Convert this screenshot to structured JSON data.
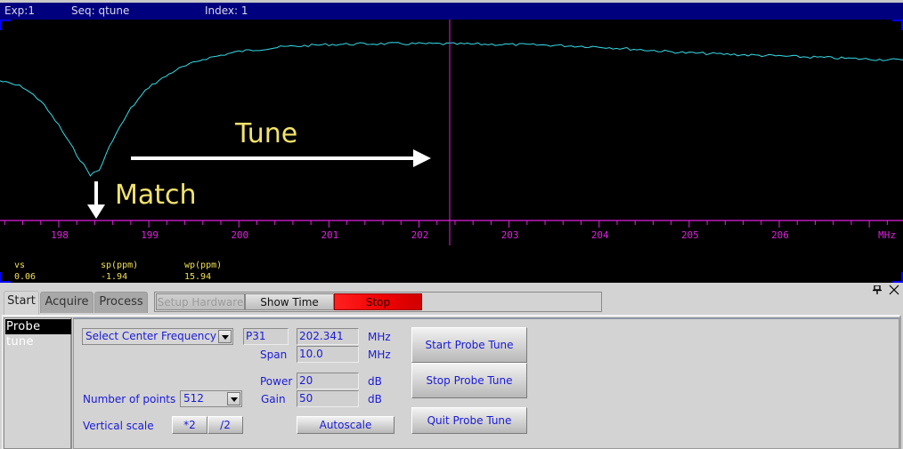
{
  "status_bar": {
    "exp": "Exp:1",
    "seq": "Seq: qtune",
    "index": "Index: 1"
  },
  "canvas": {
    "background": "#000000",
    "trace_color": "#33dde8",
    "axis_color": "#e020e0",
    "cursor_freq_mhz": 202.341,
    "annotations": {
      "tune_label": "Tune",
      "match_label": "Match",
      "label_color": "#f3e36b",
      "arrow_color": "#ffffff"
    },
    "readouts": [
      {
        "label": "vs",
        "value": "0.06"
      },
      {
        "label": "sp(ppm)",
        "value": "-1.94"
      },
      {
        "label": "wp(ppm)",
        "value": "15.94"
      }
    ]
  },
  "chart_data": {
    "type": "line",
    "title": "",
    "xlabel": "MHz",
    "ylabel": "",
    "xlim": [
      197.34,
      207.34
    ],
    "x_ticks": [
      198,
      199,
      200,
      201,
      202,
      203,
      204,
      205,
      206
    ],
    "x_tick_labels": [
      "198",
      "199",
      "200",
      "201",
      "202",
      "203",
      "204",
      "205",
      "206"
    ],
    "minor_tick_step": 0.2,
    "cursor_x": 202.341,
    "grid": false,
    "series": [
      {
        "name": "probe tune reflection",
        "x": [
          197.34,
          197.6,
          197.8,
          198.0,
          198.2,
          198.35,
          198.45,
          198.6,
          198.8,
          199.0,
          199.3,
          199.6,
          200.0,
          200.5,
          201.0,
          201.5,
          202.0,
          202.5,
          203.0,
          203.5,
          204.0,
          204.5,
          205.0,
          205.5,
          206.0,
          206.5,
          207.0,
          207.34
        ],
        "y": [
          0.73,
          0.69,
          0.6,
          0.44,
          0.25,
          0.12,
          0.15,
          0.35,
          0.55,
          0.69,
          0.8,
          0.87,
          0.92,
          0.95,
          0.965,
          0.97,
          0.97,
          0.968,
          0.965,
          0.96,
          0.95,
          0.93,
          0.91,
          0.9,
          0.89,
          0.88,
          0.87,
          0.865
        ]
      }
    ]
  },
  "panel": {
    "tabs": [
      {
        "label": "Start",
        "active": true
      },
      {
        "label": "Acquire",
        "active": false
      },
      {
        "label": "Process",
        "active": false
      }
    ],
    "toolbar": {
      "setup_hardware": "Setup Hardware",
      "show_time": "Show Time",
      "stop": "Stop"
    },
    "side_list": [
      "Probe tune"
    ],
    "form": {
      "center_freq_select": "Select Center Frequency",
      "nucleus": "P31",
      "center_freq": "202.341",
      "center_freq_unit": "MHz",
      "span_label": "Span",
      "span": "10.0",
      "span_unit": "MHz",
      "power_label": "Power",
      "power": "20",
      "power_unit": "dB",
      "gain_label": "Gain",
      "gain": "50",
      "gain_unit": "dB",
      "points_label": "Number of points",
      "points": "512",
      "vscale_label": "Vertical scale",
      "vscale_up": "*2",
      "vscale_down": "/2",
      "autoscale": "Autoscale"
    },
    "buttons": {
      "start": "Start Probe Tune",
      "stop": "Stop Probe Tune",
      "quit": "Quit Probe Tune"
    }
  }
}
